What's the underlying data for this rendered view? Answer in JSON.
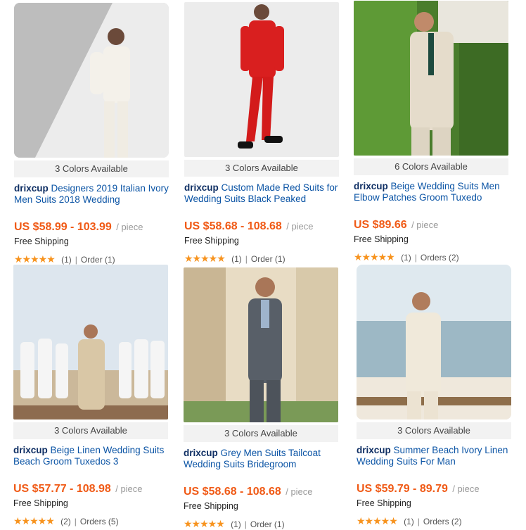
{
  "products": [
    {
      "colors": "3 Colors Available",
      "brand": "drixcup",
      "title": " Designers 2019 Italian Ivory Men Suits 2018 Wedding",
      "price": "US $58.99 - 103.99",
      "unit": "/ piece",
      "shipping": "Free Shipping",
      "rating": "★★★★★",
      "reviews": "(1)",
      "orders": "Order (1)"
    },
    {
      "colors": "3 Colors Available",
      "brand": "drixcup",
      "title": " Custom Made Red Suits for Wedding Suits Black Peaked",
      "price": "US $58.68 - 108.68",
      "unit": "/ piece",
      "shipping": "Free Shipping",
      "rating": "★★★★★",
      "reviews": "(1)",
      "orders": "Order (1)"
    },
    {
      "colors": "6 Colors Available",
      "brand": "drixcup",
      "title": " Beige Wedding Suits Men Elbow Patches Groom Tuxedo",
      "price": "US $89.66",
      "unit": "/ piece",
      "shipping": "Free Shipping",
      "rating": "★★★★★",
      "reviews": "(1)",
      "orders": "Orders (2)"
    },
    {
      "colors": "3 Colors Available",
      "brand": "drixcup",
      "title": " Beige Linen Wedding Suits Beach Groom Tuxedos 3",
      "price": "US $57.77 - 108.98",
      "unit": "/ piece",
      "shipping": "Free Shipping",
      "rating": "★★★★★",
      "reviews": "(2)",
      "orders": "Orders (5)"
    },
    {
      "colors": "3 Colors Available",
      "brand": "drixcup",
      "title": " Grey Men Suits Tailcoat Wedding Suits Bridegroom",
      "price": "US $58.68 - 108.68",
      "unit": "/ piece",
      "shipping": "Free Shipping",
      "rating": "★★★★★",
      "reviews": "(1)",
      "orders": "Order (1)"
    },
    {
      "colors": "3 Colors Available",
      "brand": "drixcup",
      "title": " Summer Beach Ivory Linen Wedding Suits For Man",
      "price": "US $59.79 - 89.79",
      "unit": "/ piece",
      "shipping": "Free Shipping",
      "rating": "★★★★★",
      "reviews": "(1)",
      "orders": "Orders (2)"
    }
  ],
  "separator": "|"
}
